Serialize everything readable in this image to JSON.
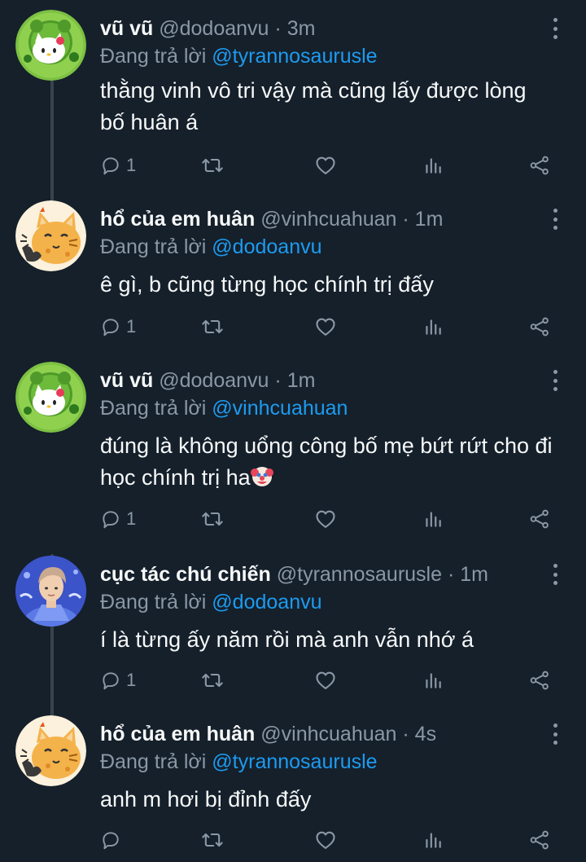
{
  "tweets": [
    {
      "name": "vũ vũ",
      "handle": "@dodoanvu",
      "time": "3m",
      "replying_prefix": "Đang trả lời",
      "replying_to": "@tyrannosaurusle",
      "text": "thằng vinh vô tri vậy mà cũng lấy được lòng bố huân á",
      "reply_count": "1",
      "avatar": "green-hello-kitty-avatar"
    },
    {
      "name": "hổ của em huân",
      "handle": "@vinhcuahuan",
      "time": "1m",
      "replying_prefix": "Đang trả lời",
      "replying_to": "@dodoanvu",
      "text": "ê gì, b cũng từng học chính trị đấy",
      "reply_count": "1",
      "avatar": "orange-cat-avatar"
    },
    {
      "name": "vũ vũ",
      "handle": "@dodoanvu",
      "time": "1m",
      "replying_prefix": "Đang trả lời",
      "replying_to": "@vinhcuahuan",
      "text": "đúng là không uổng công bố mẹ bứt rứt cho đi học chính trị ha",
      "emoji": "clown-face-icon",
      "reply_count": "1",
      "avatar": "green-hello-kitty-avatar"
    },
    {
      "name": "cục tác chú chiến",
      "handle": "@tyrannosaurusle",
      "time": "1m",
      "replying_prefix": "Đang trả lời",
      "replying_to": "@dodoanvu",
      "text": "í là từng ấy năm rồi mà anh vẫn nhớ á",
      "reply_count": "1",
      "avatar": "person-photo-avatar"
    },
    {
      "name": "hổ của em huân",
      "handle": "@vinhcuahuan",
      "time": "4s",
      "replying_prefix": "Đang trả lời",
      "replying_to": "@tyrannosaurusle",
      "text": "anh m hơi bị đỉnh đấy",
      "reply_count": "",
      "avatar": "orange-cat-avatar"
    }
  ],
  "separator": "·",
  "colors": {
    "background": "#15202b",
    "text": "#f7f9f9",
    "muted": "#8b98a5",
    "link": "#1d9bf0",
    "thread_line": "#38444d"
  }
}
